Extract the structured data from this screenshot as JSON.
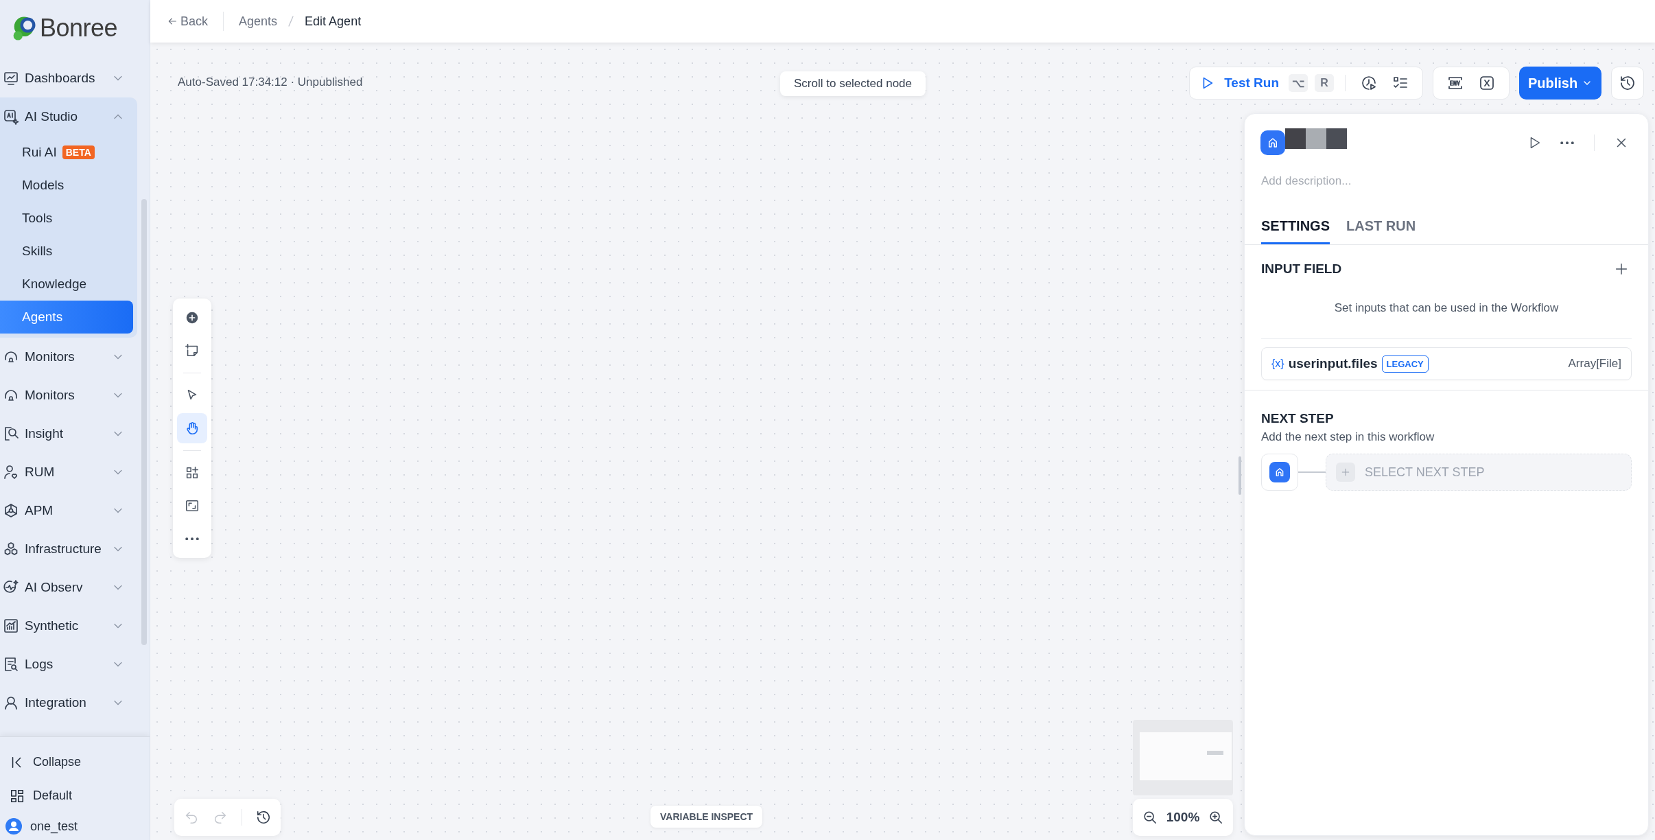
{
  "sidebar": {
    "logo": "Bonree",
    "items": [
      {
        "label": "Dashboards",
        "expanded": false
      },
      {
        "label": "AI Studio",
        "expanded": true,
        "children": [
          {
            "label": "Rui AI",
            "badge": "BETA",
            "selected": false
          },
          {
            "label": "Models",
            "selected": false
          },
          {
            "label": "Tools",
            "selected": false
          },
          {
            "label": "Skills",
            "selected": false
          },
          {
            "label": "Knowledge",
            "selected": false
          },
          {
            "label": "Agents",
            "selected": true
          }
        ]
      },
      {
        "label": "Monitors",
        "expanded": false
      },
      {
        "label": "Monitors",
        "expanded": false
      },
      {
        "label": "Insight",
        "expanded": false
      },
      {
        "label": "RUM",
        "expanded": false
      },
      {
        "label": "APM",
        "expanded": false
      },
      {
        "label": "Infrastructure",
        "expanded": false
      },
      {
        "label": "AI Observ",
        "expanded": false
      },
      {
        "label": "Synthetic",
        "expanded": false
      },
      {
        "label": "Logs",
        "expanded": false
      },
      {
        "label": "Integration",
        "expanded": false
      }
    ],
    "footer": {
      "collapse": "Collapse",
      "layout": "Default",
      "user": "one_test"
    }
  },
  "header": {
    "back": "Back",
    "breadcrumb": [
      "Agents",
      "Edit Agent"
    ]
  },
  "canvas": {
    "status": "Auto-Saved 17:34:12 · Unpublished",
    "scroll_button": "Scroll to selected node",
    "tools": [
      {
        "selected": false
      },
      {
        "selected": false
      },
      {
        "selected": false
      },
      {
        "selected": true
      },
      {
        "selected": false
      },
      {
        "selected": false
      },
      {
        "selected": false
      }
    ],
    "history": {
      "undo_disabled": true,
      "redo_disabled": true
    },
    "variable_inspect": "VARIABLE INSPECT",
    "zoom": "100%"
  },
  "toolbar": {
    "test_run": {
      "label": "Test Run",
      "shortcut": [
        "⌥",
        "R"
      ]
    },
    "publish": "Publish"
  },
  "panel": {
    "description": {
      "placeholder": "Add description..."
    },
    "tabs": [
      {
        "label": "SETTINGS",
        "selected": true
      },
      {
        "label": "LAST RUN",
        "selected": false
      }
    ],
    "input_field": {
      "title": "INPUT FIELD",
      "hint": "Set inputs that can be used in the Workflow",
      "variables": [
        {
          "prefix": "{x}",
          "name": "userinput.files",
          "badge": "LEGACY",
          "type": "Array[File]"
        }
      ]
    },
    "next_step": {
      "title": "NEXT STEP",
      "subtitle": "Add the next step in this workflow",
      "button": "SELECT NEXT STEP"
    }
  }
}
